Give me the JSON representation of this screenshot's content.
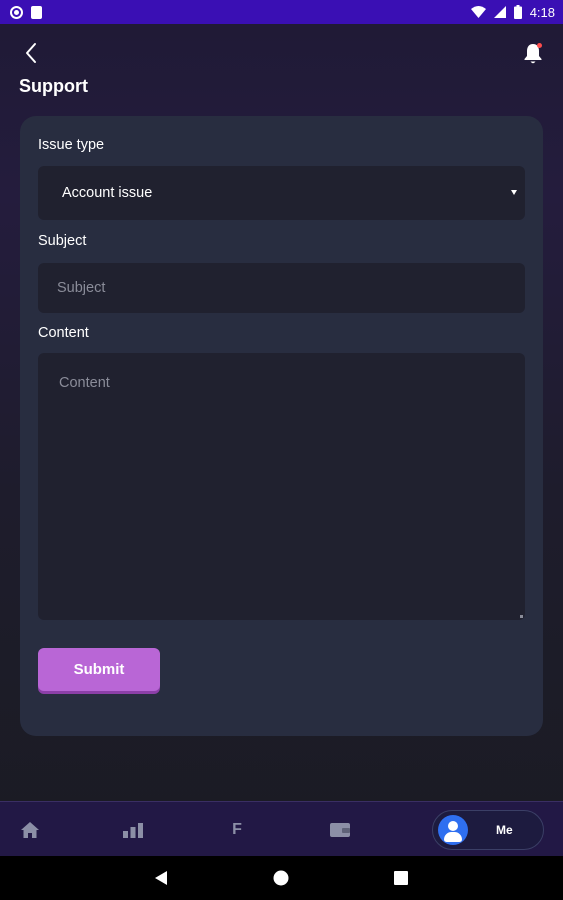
{
  "status_bar": {
    "time": "4:18",
    "icons": [
      "circle-notification-icon",
      "sim-card-icon",
      "wifi-icon",
      "signal-icon",
      "battery-icon"
    ]
  },
  "header": {
    "title": "Support",
    "back_icon": "chevron-left-icon",
    "notification_icon": "bell-icon"
  },
  "form": {
    "issue_type": {
      "label": "Issue type",
      "selected": "Account issue"
    },
    "subject": {
      "label": "Subject",
      "placeholder": "Subject",
      "value": ""
    },
    "content": {
      "label": "Content",
      "placeholder": "Content",
      "value": ""
    },
    "submit_label": "Submit"
  },
  "tab_bar": {
    "items": [
      {
        "icon": "home-icon"
      },
      {
        "icon": "bar-chart-icon"
      },
      {
        "label": "F"
      },
      {
        "icon": "wallet-icon"
      },
      {
        "icon": "user-avatar-icon",
        "label": "Me",
        "active": true
      }
    ]
  },
  "nav_bar": {
    "icons": [
      "back-triangle-icon",
      "home-circle-icon",
      "recents-square-icon"
    ]
  },
  "colors": {
    "status_bar": "#3a0fb4",
    "card": "#282d40",
    "field": "#20212f",
    "accent": "#b966d6",
    "tab_bar": "#221845",
    "avatar": "#2f6ff0"
  }
}
